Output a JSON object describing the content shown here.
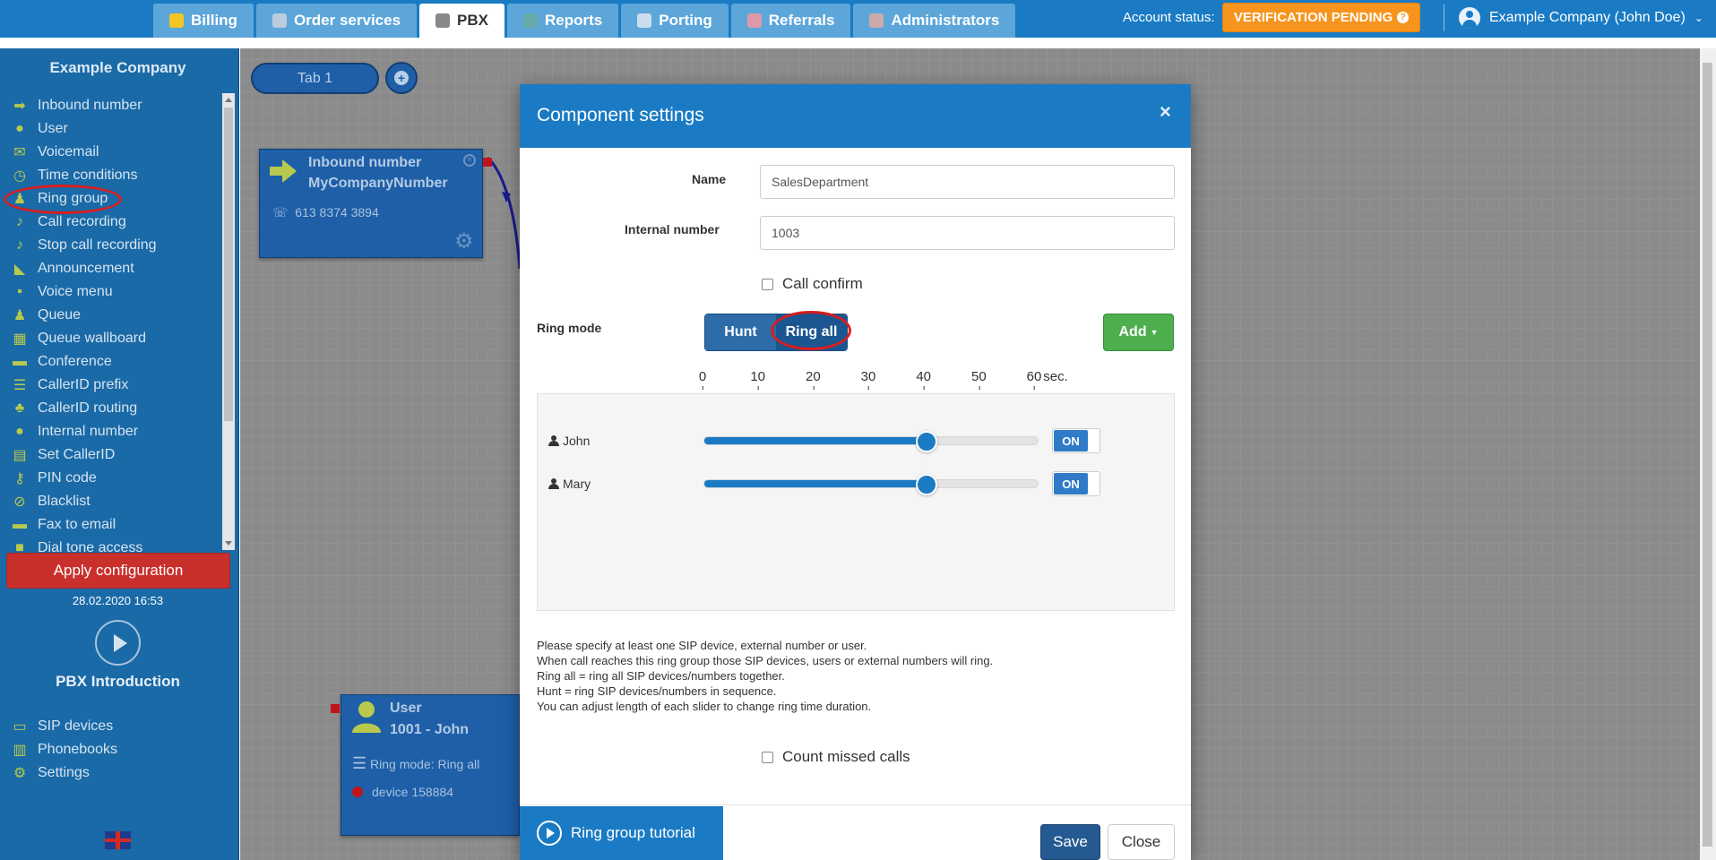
{
  "nav": {
    "tabs": [
      {
        "label": "Billing",
        "icon": "coins-icon"
      },
      {
        "label": "Order services",
        "icon": "cart-icon"
      },
      {
        "label": "PBX",
        "icon": "pbx-icon",
        "active": true
      },
      {
        "label": "Reports",
        "icon": "reports-icon"
      },
      {
        "label": "Porting",
        "icon": "phone-icon"
      },
      {
        "label": "Referrals",
        "icon": "referrals-icon"
      },
      {
        "label": "Administrators",
        "icon": "admin-icon"
      }
    ],
    "account_status_label": "Account status:",
    "verification_label": "VERIFICATION PENDING",
    "user_label": "Example Company (John Doe)"
  },
  "sidebar": {
    "company": "Example Company",
    "components": [
      {
        "label": "Inbound number",
        "icon": "arrow-right-icon"
      },
      {
        "label": "User",
        "icon": "user-icon"
      },
      {
        "label": "Voicemail",
        "icon": "envelope-icon"
      },
      {
        "label": "Time conditions",
        "icon": "clock-icon"
      },
      {
        "label": "Ring group",
        "icon": "group-icon"
      },
      {
        "label": "Call recording",
        "icon": "microphone-icon"
      },
      {
        "label": "Stop call recording",
        "icon": "microphone-off-icon"
      },
      {
        "label": "Announcement",
        "icon": "megaphone-icon"
      },
      {
        "label": "Voice menu",
        "icon": "grid-icon"
      },
      {
        "label": "Queue",
        "icon": "queue-icon"
      },
      {
        "label": "Queue wallboard",
        "icon": "table-icon"
      },
      {
        "label": "Conference",
        "icon": "conference-icon"
      },
      {
        "label": "CallerID prefix",
        "icon": "list-icon"
      },
      {
        "label": "CallerID routing",
        "icon": "routing-icon"
      },
      {
        "label": "Internal number",
        "icon": "pin-icon"
      },
      {
        "label": "Set CallerID",
        "icon": "id-card-icon"
      },
      {
        "label": "PIN code",
        "icon": "key-icon"
      },
      {
        "label": "Blacklist",
        "icon": "ban-icon"
      },
      {
        "label": "Fax to email",
        "icon": "fax-icon"
      },
      {
        "label": "Dial tone access",
        "icon": "lock-icon"
      }
    ],
    "apply_label": "Apply configuration",
    "apply_date": "28.02.2020 16:53",
    "pbx_intro": "PBX Introduction",
    "bottom_items": [
      {
        "label": "SIP devices",
        "icon": "monitor-icon"
      },
      {
        "label": "Phonebooks",
        "icon": "book-icon"
      },
      {
        "label": "Settings",
        "icon": "gear-icon"
      }
    ]
  },
  "canvas": {
    "tab_label": "Tab 1",
    "inbound_node": {
      "title": "Inbound number",
      "name": "MyCompanyNumber",
      "phone": "613 8374 3894"
    },
    "user_node": {
      "title": "User",
      "name": "1001 - John",
      "ring_mode": "Ring mode: Ring all",
      "device": "device 158884"
    }
  },
  "modal": {
    "title": "Component settings",
    "name_label": "Name",
    "name_value": "SalesDepartment",
    "internal_label": "Internal number",
    "internal_value": "1003",
    "call_confirm_label": "Call confirm",
    "ring_mode_label": "Ring mode",
    "ring_modes": [
      "Hunt",
      "Ring all"
    ],
    "ring_mode_selected": "Ring all",
    "add_label": "Add",
    "scale_ticks": [
      "0",
      "10",
      "20",
      "30",
      "40",
      "50",
      "60"
    ],
    "scale_unit": "sec.",
    "members": [
      {
        "name": "John",
        "ring_seconds": 40,
        "toggle": "ON"
      },
      {
        "name": "Mary",
        "ring_seconds": 40,
        "toggle": "ON"
      }
    ],
    "help_lines": [
      "Please specify at least one SIP device, external number or user.",
      "When call reaches this ring group those SIP devices, users or external numbers will ring.",
      "Ring all = ring all SIP devices/numbers together.",
      "Hunt = ring SIP devices/numbers in sequence.",
      "You can adjust length of each slider to change ring time duration."
    ],
    "count_missed_label": "Count missed calls",
    "tutorial_label": "Ring group tutorial",
    "save_label": "Save",
    "close_label": "Close"
  }
}
